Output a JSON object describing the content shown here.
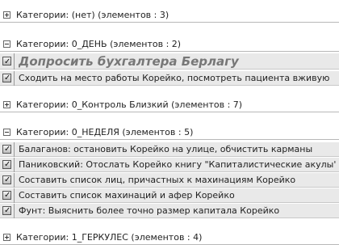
{
  "groups": [
    {
      "label": "Категории: (нет) (элементов : 3)",
      "expanded": false
    },
    {
      "label": "Категории: 0_ДЕНЬ (элементов : 2)",
      "expanded": true,
      "tasks": [
        "Допросить бухгалтера Берлагу",
        "Сходить на место работы Корейко, посмотреть пациента вживую"
      ]
    },
    {
      "label": "Категории: 0_Контроль Близкий (элементов : 7)",
      "expanded": false
    },
    {
      "label": "Категории: 0_НЕДЕЛЯ (элементов : 5)",
      "expanded": true,
      "tasks": [
        "Балаганов: остановить Корейко на улице, обчистить карманы",
        "Паниковский: Отослать Корейко книгу \"Капиталистические   акулы\"  (\"Б…",
        "Составить список лиц, причастных к махинациям Корейко",
        "Составить список махинаций и афер Корейко",
        "Фунт: Выяснить более точно размер капитала Корейко"
      ]
    },
    {
      "label": "Категории: 1_ГЕРКУЛЕС (элементов : 4)",
      "expanded": false
    }
  ]
}
